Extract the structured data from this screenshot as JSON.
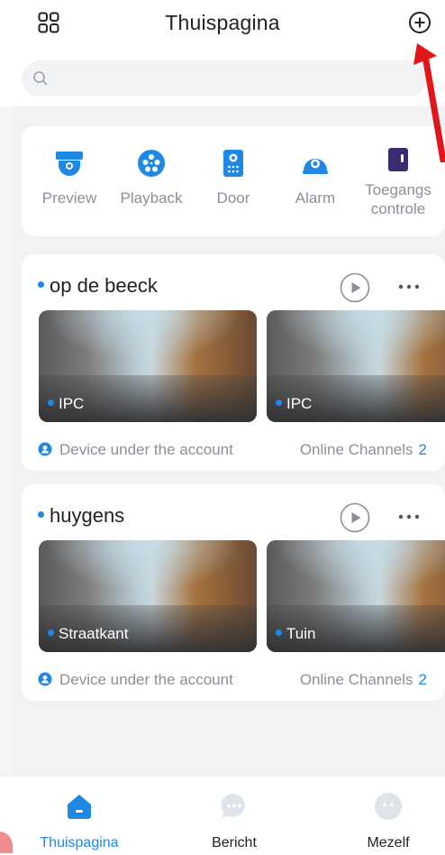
{
  "header": {
    "title": "Thuispagina",
    "menu_icon": "grid-menu-icon",
    "add_icon": "add-circle-icon"
  },
  "search": {
    "placeholder": "",
    "value": ""
  },
  "quick_actions": [
    {
      "label": "Preview",
      "icon": "camera-dome-icon"
    },
    {
      "label": "Playback",
      "icon": "playback-reel-icon"
    },
    {
      "label": "Door",
      "icon": "door-intercom-icon"
    },
    {
      "label": "Alarm",
      "icon": "alarm-icon"
    },
    {
      "label": "Toegangs",
      "label2": "controle",
      "icon": "access-control-icon"
    }
  ],
  "cards": [
    {
      "title": "op de beeck",
      "cameras": [
        "IPC",
        "IPC"
      ],
      "footer": "Device under the account",
      "online_label": "Online Channels",
      "online_count": "2"
    },
    {
      "title": "huygens",
      "cameras": [
        "Straatkant",
        "Tuin"
      ],
      "footer": "Device under the account",
      "online_label": "Online Channels",
      "online_count": "2"
    }
  ],
  "bottom_nav": [
    {
      "label": "Thuispagina",
      "icon": "home-icon",
      "active": true
    },
    {
      "label": "Bericht",
      "icon": "message-icon",
      "active": false
    },
    {
      "label": "Mezelf",
      "icon": "profile-icon",
      "active": false
    }
  ],
  "colors": {
    "accent": "#1e88e5",
    "access_purple": "#3a2a6e",
    "annotation_arrow": "#e0161b",
    "inactive_icon": "#dfe3ea"
  }
}
